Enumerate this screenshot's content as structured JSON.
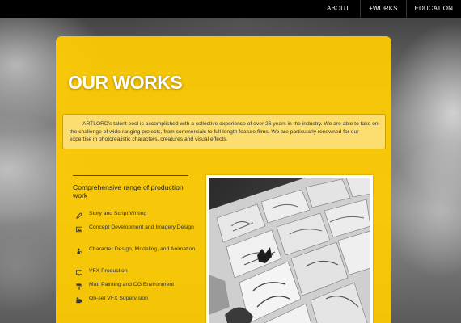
{
  "nav": {
    "items": [
      {
        "label": "ABOUT"
      },
      {
        "label": "+WORKS"
      },
      {
        "label": "EDUCATION"
      }
    ]
  },
  "main": {
    "title": "OUR WORKS",
    "intro": "ARTLORD's talent pool is accomplished with a collective experience of over 26 years in the industry. We are able to take on the challenge of wide-ranging projects, from commercials to full-length feature films. We are particularly renowned for our expertise in photorealistic characters, creatures and visual effects.",
    "section_title": "Comprehensive range of production work",
    "services": [
      {
        "label": "Story and Script Writing",
        "icon": "pencil-icon"
      },
      {
        "label": "Concept Development and Imagery Design",
        "icon": "image-icon"
      },
      {
        "label": "Character Design, Modeling, and Animation",
        "icon": "character-icon"
      },
      {
        "label": "VFX Production",
        "icon": "monitor-icon"
      },
      {
        "label": "Matt Painting and CG Environment",
        "icon": "paint-roller-icon"
      },
      {
        "label": "On-set VFX Supervision",
        "icon": "camera-icon"
      }
    ]
  },
  "colors": {
    "panel": "#ffcc00",
    "topbar": "#000000",
    "title": "#ffffff"
  }
}
